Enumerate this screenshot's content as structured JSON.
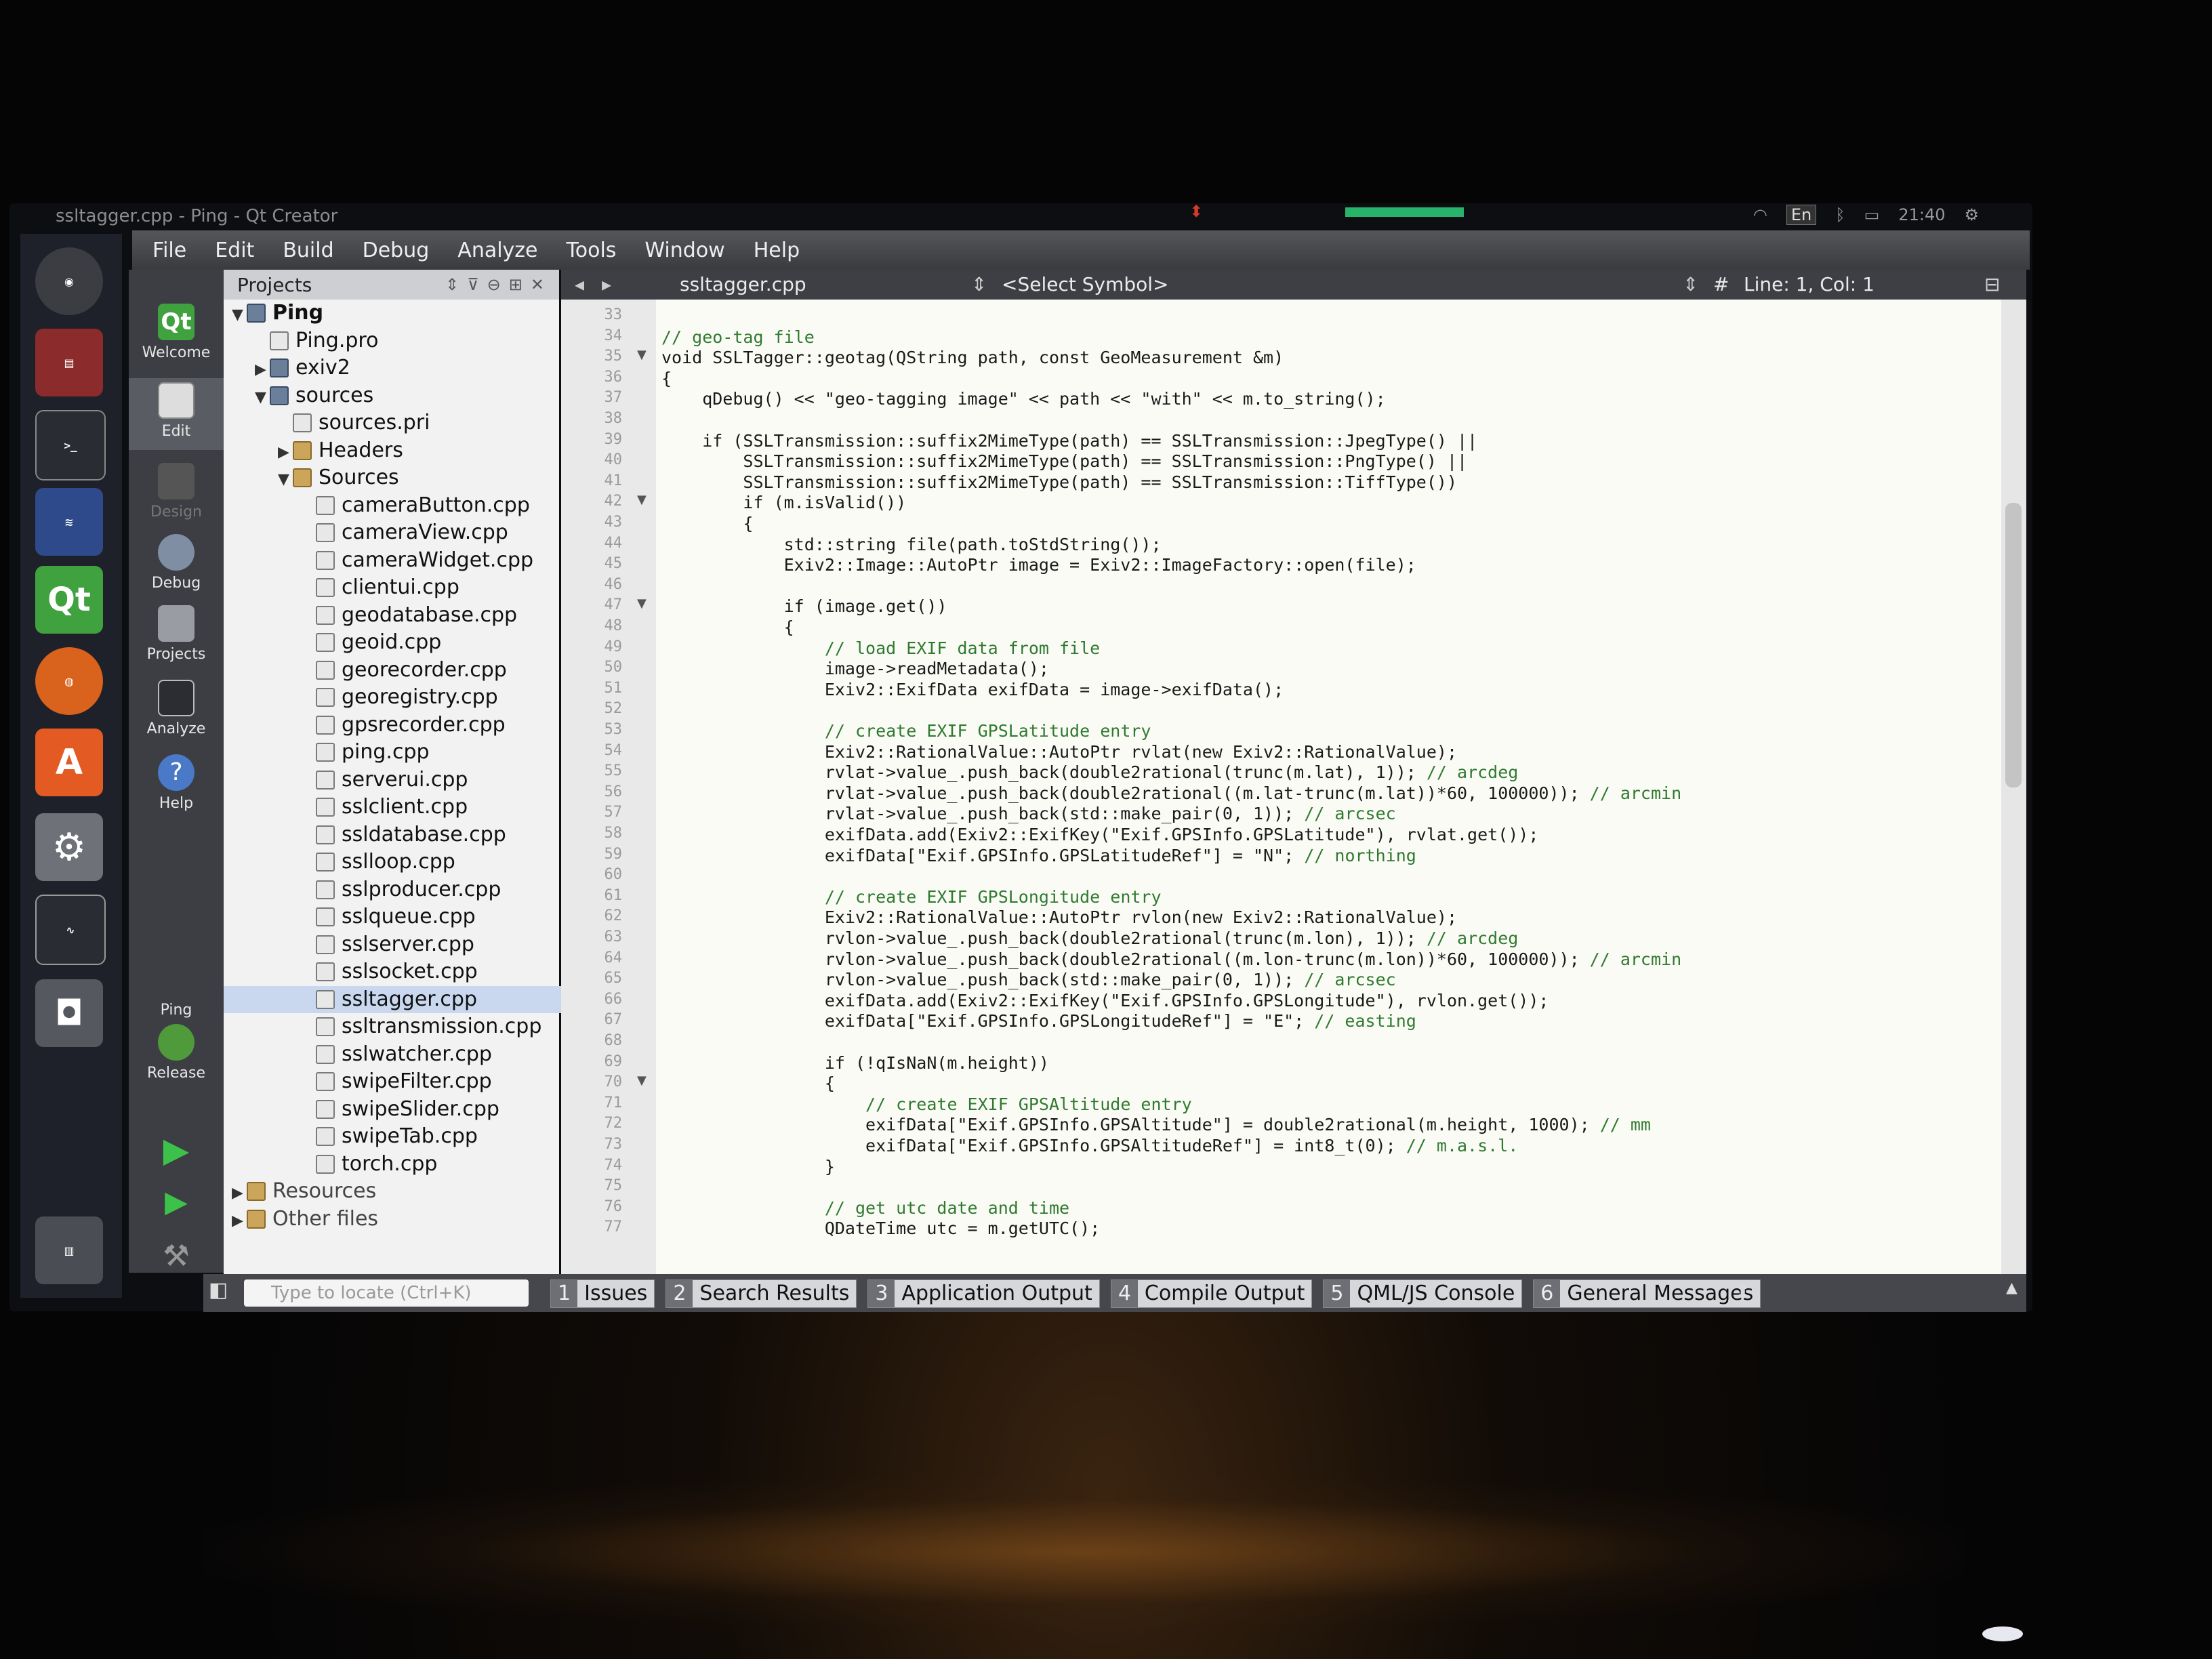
{
  "window_title": "ssltagger.cpp - Ping - Qt Creator",
  "indicators": {
    "keyboard": "En",
    "clock": "21:40"
  },
  "menu": [
    "File",
    "Edit",
    "Build",
    "Debug",
    "Analyze",
    "Tools",
    "Window",
    "Help"
  ],
  "modes": [
    "Welcome",
    "Edit",
    "Design",
    "Debug",
    "Projects",
    "Analyze",
    "Help"
  ],
  "kit": {
    "project": "Ping",
    "build": "Release"
  },
  "projects_panel": {
    "title": "Projects",
    "tree": [
      {
        "label": "Ping",
        "depth": 0,
        "caret": "▼",
        "kind": "project"
      },
      {
        "label": "Ping.pro",
        "depth": 1,
        "caret": "",
        "kind": "file"
      },
      {
        "label": "exiv2",
        "depth": 1,
        "caret": "▶",
        "kind": "project"
      },
      {
        "label": "sources",
        "depth": 1,
        "caret": "▼",
        "kind": "project"
      },
      {
        "label": "sources.pri",
        "depth": 2,
        "caret": "",
        "kind": "file"
      },
      {
        "label": "Headers",
        "depth": 2,
        "caret": "▶",
        "kind": "folder"
      },
      {
        "label": "Sources",
        "depth": 2,
        "caret": "▼",
        "kind": "folder"
      },
      {
        "label": "cameraButton.cpp",
        "depth": 3,
        "caret": "",
        "kind": "file"
      },
      {
        "label": "cameraView.cpp",
        "depth": 3,
        "caret": "",
        "kind": "file"
      },
      {
        "label": "cameraWidget.cpp",
        "depth": 3,
        "caret": "",
        "kind": "file"
      },
      {
        "label": "clientui.cpp",
        "depth": 3,
        "caret": "",
        "kind": "file"
      },
      {
        "label": "geodatabase.cpp",
        "depth": 3,
        "caret": "",
        "kind": "file"
      },
      {
        "label": "geoid.cpp",
        "depth": 3,
        "caret": "",
        "kind": "file"
      },
      {
        "label": "georecorder.cpp",
        "depth": 3,
        "caret": "",
        "kind": "file"
      },
      {
        "label": "georegistry.cpp",
        "depth": 3,
        "caret": "",
        "kind": "file"
      },
      {
        "label": "gpsrecorder.cpp",
        "depth": 3,
        "caret": "",
        "kind": "file"
      },
      {
        "label": "ping.cpp",
        "depth": 3,
        "caret": "",
        "kind": "file"
      },
      {
        "label": "serverui.cpp",
        "depth": 3,
        "caret": "",
        "kind": "file"
      },
      {
        "label": "sslclient.cpp",
        "depth": 3,
        "caret": "",
        "kind": "file"
      },
      {
        "label": "ssldatabase.cpp",
        "depth": 3,
        "caret": "",
        "kind": "file"
      },
      {
        "label": "sslloop.cpp",
        "depth": 3,
        "caret": "",
        "kind": "file"
      },
      {
        "label": "sslproducer.cpp",
        "depth": 3,
        "caret": "",
        "kind": "file"
      },
      {
        "label": "sslqueue.cpp",
        "depth": 3,
        "caret": "",
        "kind": "file"
      },
      {
        "label": "sslserver.cpp",
        "depth": 3,
        "caret": "",
        "kind": "file"
      },
      {
        "label": "sslsocket.cpp",
        "depth": 3,
        "caret": "",
        "kind": "file"
      },
      {
        "label": "ssltagger.cpp",
        "depth": 3,
        "caret": "",
        "kind": "file",
        "selected": true
      },
      {
        "label": "ssltransmission.cpp",
        "depth": 3,
        "caret": "",
        "kind": "file"
      },
      {
        "label": "sslwatcher.cpp",
        "depth": 3,
        "caret": "",
        "kind": "file"
      },
      {
        "label": "swipeFilter.cpp",
        "depth": 3,
        "caret": "",
        "kind": "file"
      },
      {
        "label": "swipeSlider.cpp",
        "depth": 3,
        "caret": "",
        "kind": "file"
      },
      {
        "label": "swipeTab.cpp",
        "depth": 3,
        "caret": "",
        "kind": "file"
      },
      {
        "label": "torch.cpp",
        "depth": 3,
        "caret": "",
        "kind": "file"
      },
      {
        "label": "Resources",
        "depth": 0,
        "caret": "▶",
        "kind": "folder"
      },
      {
        "label": "Other files",
        "depth": 0,
        "caret": "▶",
        "kind": "folder"
      }
    ]
  },
  "editor": {
    "file": "ssltagger.cpp",
    "symbol": "<Select Symbol>",
    "position": "Line: 1, Col: 1",
    "first_line_number": 33,
    "fold_lines": [
      35,
      42,
      47,
      70
    ],
    "lines": [
      "",
      "// geo-tag file",
      "void SSLTagger::geotag(QString path, const GeoMeasurement &m)",
      "{",
      "    qDebug() << \"geo-tagging image\" << path << \"with\" << m.to_string();",
      "",
      "    if (SSLTransmission::suffix2MimeType(path) == SSLTransmission::JpegType() ||",
      "        SSLTransmission::suffix2MimeType(path) == SSLTransmission::PngType() ||",
      "        SSLTransmission::suffix2MimeType(path) == SSLTransmission::TiffType())",
      "        if (m.isValid())",
      "        {",
      "            std::string file(path.toStdString());",
      "            Exiv2::Image::AutoPtr image = Exiv2::ImageFactory::open(file);",
      "",
      "            if (image.get())",
      "            {",
      "                // load EXIF data from file",
      "                image->readMetadata();",
      "                Exiv2::ExifData exifData = image->exifData();",
      "",
      "                // create EXIF GPSLatitude entry",
      "                Exiv2::RationalValue::AutoPtr rvlat(new Exiv2::RationalValue);",
      "                rvlat->value_.push_back(double2rational(trunc(m.lat), 1)); // arcdeg",
      "                rvlat->value_.push_back(double2rational((m.lat-trunc(m.lat))*60, 100000)); // arcmin",
      "                rvlat->value_.push_back(std::make_pair(0, 1)); // arcsec",
      "                exifData.add(Exiv2::ExifKey(\"Exif.GPSInfo.GPSLatitude\"), rvlat.get());",
      "                exifData[\"Exif.GPSInfo.GPSLatitudeRef\"] = \"N\"; // northing",
      "",
      "                // create EXIF GPSLongitude entry",
      "                Exiv2::RationalValue::AutoPtr rvlon(new Exiv2::RationalValue);",
      "                rvlon->value_.push_back(double2rational(trunc(m.lon), 1)); // arcdeg",
      "                rvlon->value_.push_back(double2rational((m.lon-trunc(m.lon))*60, 100000)); // arcmin",
      "                rvlon->value_.push_back(std::make_pair(0, 1)); // arcsec",
      "                exifData.add(Exiv2::ExifKey(\"Exif.GPSInfo.GPSLongitude\"), rvlon.get());",
      "                exifData[\"Exif.GPSInfo.GPSLongitudeRef\"] = \"E\"; // easting",
      "",
      "                if (!qIsNaN(m.height))",
      "                {",
      "                    // create EXIF GPSAltitude entry",
      "                    exifData[\"Exif.GPSInfo.GPSAltitude\"] = double2rational(m.height, 1000); // mm",
      "                    exifData[\"Exif.GPSInfo.GPSAltitudeRef\"] = int8_t(0); // m.a.s.l.",
      "                }",
      "",
      "                // get utc date and time",
      "                QDateTime utc = m.getUTC();"
    ]
  },
  "statusbar": {
    "locator_placeholder": "Type to locate (Ctrl+K)",
    "tabs": [
      {
        "num": "1",
        "label": "Issues"
      },
      {
        "num": "2",
        "label": "Search Results"
      },
      {
        "num": "3",
        "label": "Application Output"
      },
      {
        "num": "4",
        "label": "Compile Output"
      },
      {
        "num": "5",
        "label": "QML/JS Console"
      },
      {
        "num": "6",
        "label": "General Messages"
      }
    ]
  }
}
